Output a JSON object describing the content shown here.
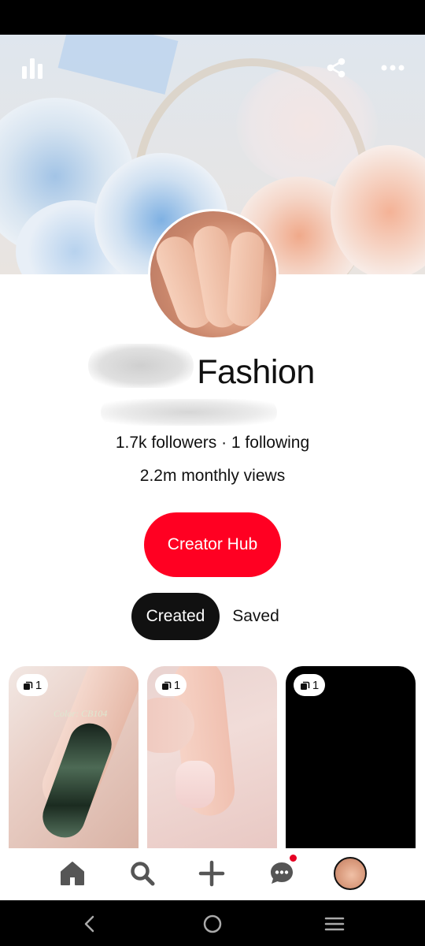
{
  "profile": {
    "name": "Fashion",
    "stats": "1.7k followers · 1 following",
    "monthly_views": "2.2m monthly views"
  },
  "actions": {
    "creator_hub_label": "Creator Hub"
  },
  "tabs": [
    {
      "label": "Created",
      "selected": true
    },
    {
      "label": "Saved",
      "selected": false
    }
  ],
  "pins": [
    {
      "badge_count": "1",
      "image_text": "Color: CB104"
    },
    {
      "badge_count": "1"
    },
    {
      "badge_count": "1"
    }
  ],
  "bottom_nav": {
    "items": [
      "home-icon",
      "search-icon",
      "plus-icon",
      "messages-icon",
      "profile-avatar"
    ],
    "has_message_notification": true
  },
  "colors": {
    "accent": "#e60023",
    "creator_hub_bg": "#ff0022",
    "tab_selected_bg": "#111111"
  }
}
